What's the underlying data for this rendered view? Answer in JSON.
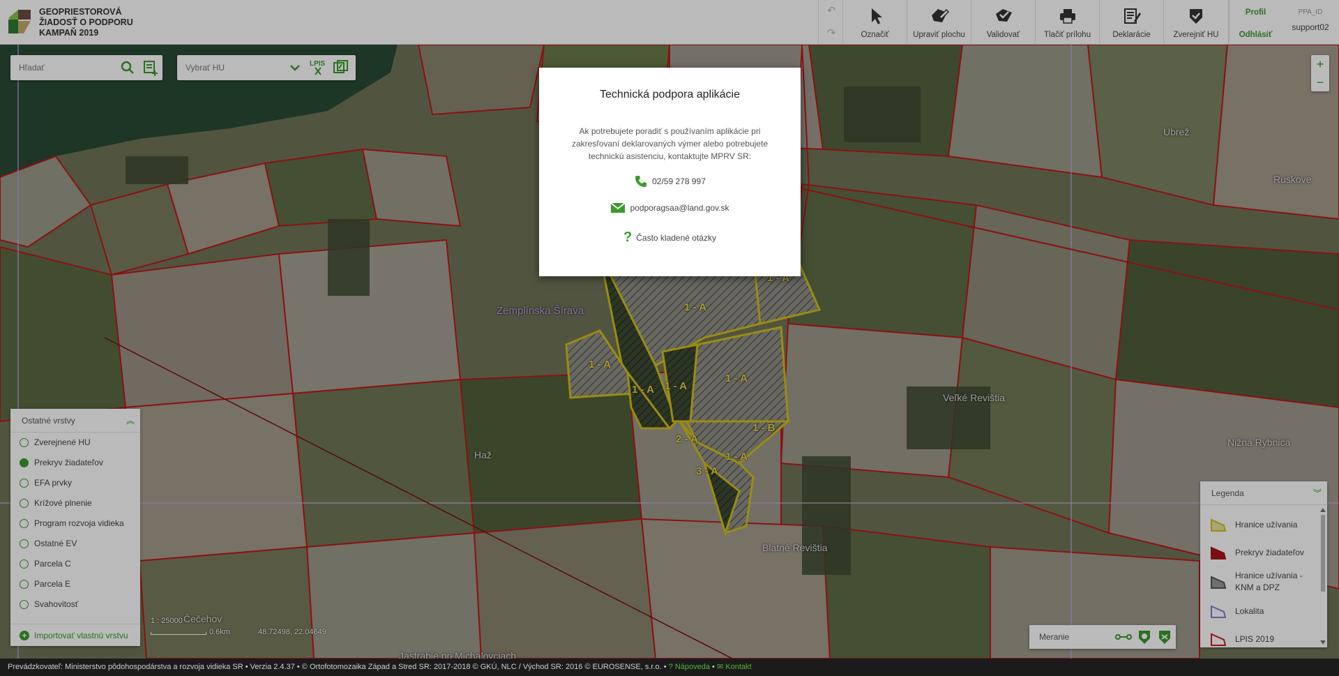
{
  "header": {
    "app_title_lines": [
      "GEOPRIESTOROVÁ",
      "ŽIADOSŤ O PODPORU",
      "KAMPAŇ 2019"
    ],
    "tools": [
      {
        "label": "Označiť",
        "icon": "cursor-icon"
      },
      {
        "label": "Upraviť plochu",
        "icon": "edit-area-icon"
      },
      {
        "label": "Validovať",
        "icon": "validate-icon"
      },
      {
        "label": "Tlačiť prílohu",
        "icon": "printer-icon"
      },
      {
        "label": "Deklarácie",
        "icon": "declarations-icon"
      },
      {
        "label": "Zverejniť HU",
        "icon": "publish-shield-icon"
      }
    ],
    "profile_label": "Profil",
    "logout_label": "Odhlásiť",
    "user_id_label": "PPA_ID",
    "username": "support02"
  },
  "search": {
    "placeholder": "Hľadať"
  },
  "hu_select": {
    "value": "Vybrať HU"
  },
  "lpis_label": "LPIS",
  "zoom": {
    "in": "+",
    "out": "−"
  },
  "map_labels": [
    {
      "text": "Zemplínska Šírava",
      "kind": "lake"
    },
    {
      "text": "Veľké Revištia",
      "kind": "place"
    },
    {
      "text": "Blatné Revištia",
      "kind": "place"
    },
    {
      "text": "Ruskove",
      "kind": "place"
    },
    {
      "text": "Nižná Rybnica",
      "kind": "place"
    },
    {
      "text": "Ubrež",
      "kind": "place"
    },
    {
      "text": "Haž",
      "kind": "place"
    },
    {
      "text": "Čečehov",
      "kind": "place"
    },
    {
      "text": "Jastrabie pri Michalovciach",
      "kind": "place"
    }
  ],
  "parcel_codes": [
    "1 - A",
    "1 - A",
    "1 - A",
    "1 - A",
    "1 - A",
    "1 - A",
    "1 - B",
    "2 - A",
    "1 - A",
    "3 - A"
  ],
  "layers_panel": {
    "title": "Ostatné vrstvy",
    "items": [
      {
        "label": "Zverejnené HU",
        "checked": false
      },
      {
        "label": "Prekryv žiadateľov",
        "checked": true
      },
      {
        "label": "EFA prvky",
        "checked": false
      },
      {
        "label": "Krížové plnenie",
        "checked": false
      },
      {
        "label": "Program rozvoja vidieka",
        "checked": false
      },
      {
        "label": "Ostatné EV",
        "checked": false
      },
      {
        "label": "Parcela C",
        "checked": false
      },
      {
        "label": "Parcela E",
        "checked": false
      },
      {
        "label": "Svahovitosť",
        "checked": false
      }
    ],
    "import_label": "Importovať vlastnú vrstvu"
  },
  "scale": {
    "ratio": "1 : 25000",
    "distance": "0.6km",
    "coords": "48.72498, 22.04649"
  },
  "measure": {
    "label": "Meranie"
  },
  "legend": {
    "title": "Legenda",
    "items": [
      {
        "label": "Hranice užívania",
        "color": "#d4c11a"
      },
      {
        "label": "Prekryv žiadateľov",
        "color": "#a8151b"
      },
      {
        "label": "Hranice užívania - KNM a DPZ",
        "color": "#555555"
      },
      {
        "label": "Lokalita",
        "color": "#8c7ad0"
      },
      {
        "label": "LPIS 2019",
        "color": "#d11a1a"
      }
    ]
  },
  "footer": {
    "text": "Prevádzkovateľ: Ministerstvo pôdohospodárstva a rozvoja vidieka SR • Verzia 2.4.37 • © Ortofotomozaika Západ a Stred SR: 2017-2018 © GKÚ, NLC / Východ SR: 2016 © EUROSENSE, s.r.o. •",
    "help_label": "Nápoveda",
    "contact_label": "Kontakt"
  },
  "modal": {
    "title": "Technická podpora aplikácie",
    "description": "Ak potrebujete poradiť s používaním aplikácie pri zakresľovaní deklarovaných výmer alebo potrebujete technickú asistenciu, kontaktujte MPRV SR:",
    "phone": "02/59 278 997",
    "email": "podporagsaa@land.gov.sk",
    "faq": "Často kladené otázky"
  },
  "colors": {
    "accent": "#3a9a2d",
    "parcel_border": "#d11a1a",
    "usage_border": "#d4c11a"
  }
}
